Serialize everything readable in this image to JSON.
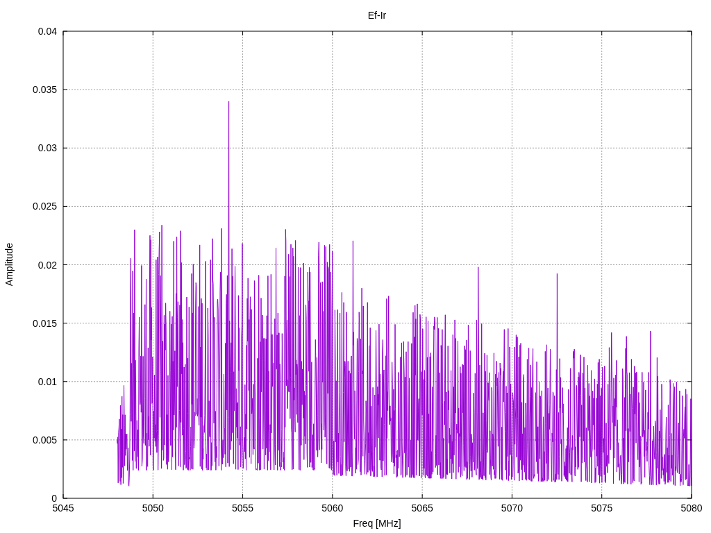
{
  "plot": {
    "title": "Ef-Ir",
    "ylabel": "Amplitude",
    "xlabel": "Freq [MHz]",
    "xticks": [
      "5045",
      "5050",
      "5055",
      "5060",
      "5065",
      "5070",
      "5075",
      "5080"
    ],
    "yticks": [
      "0.04",
      "0.035",
      "0.03",
      "0.025",
      "0.02",
      "0.015",
      "0.01",
      "0.005",
      "0"
    ]
  }
}
